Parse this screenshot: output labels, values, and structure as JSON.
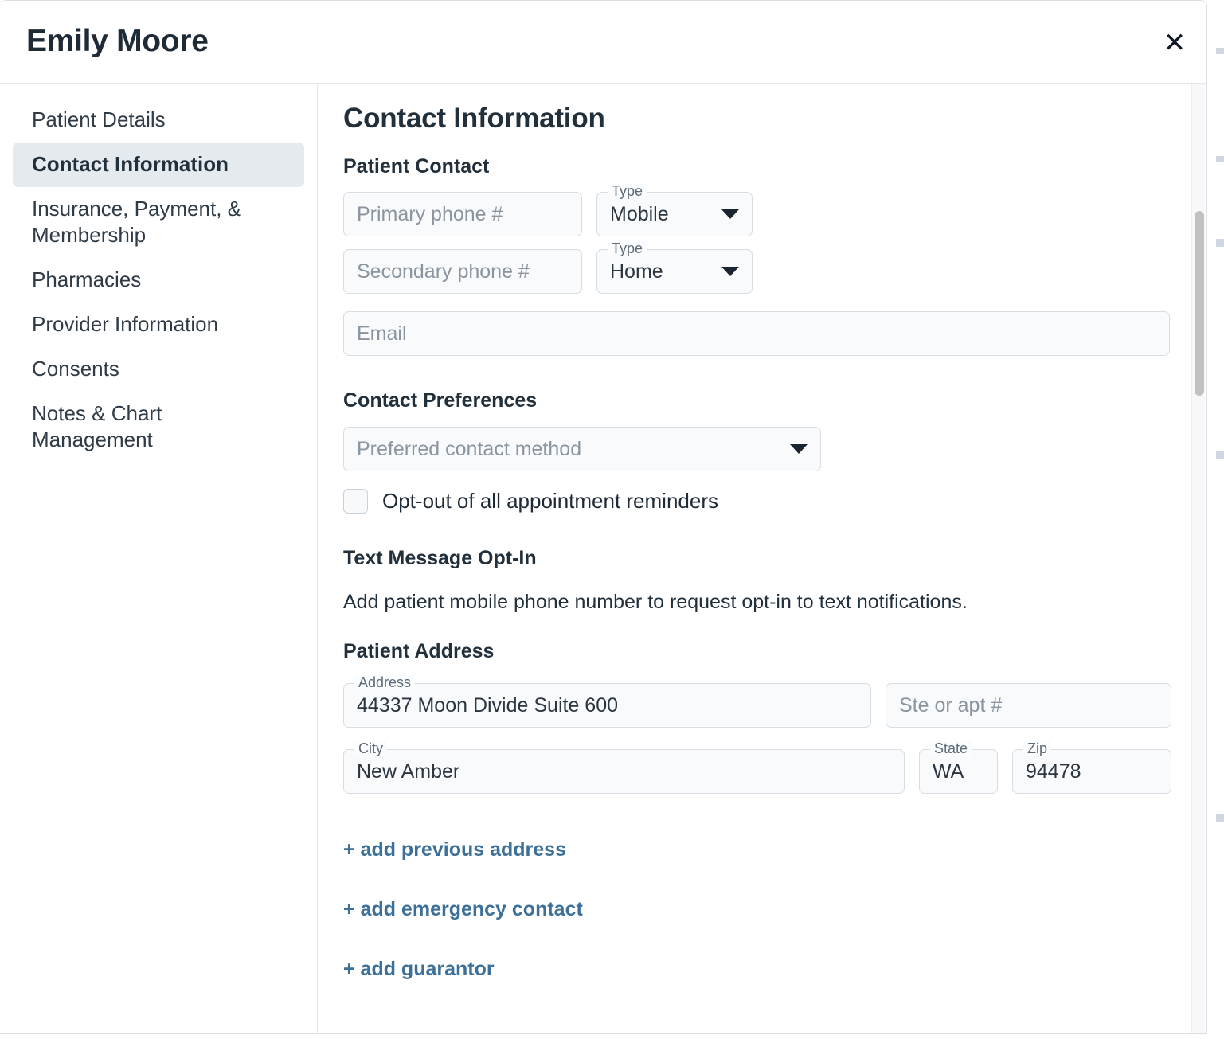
{
  "dialog": {
    "title": "Emily Moore",
    "close_icon": "close-icon"
  },
  "sidebar": {
    "items": [
      {
        "label": "Patient Details",
        "active": false
      },
      {
        "label": "Contact Information",
        "active": true
      },
      {
        "label": "Insurance, Payment, & Membership",
        "active": false
      },
      {
        "label": "Pharmacies",
        "active": false
      },
      {
        "label": "Provider Information",
        "active": false
      },
      {
        "label": "Consents",
        "active": false
      },
      {
        "label": "Notes & Chart Management",
        "active": false
      }
    ]
  },
  "main": {
    "section_title": "Contact Information",
    "patient_contact": {
      "heading": "Patient Contact",
      "primary_phone": {
        "label": "",
        "placeholder": "Primary phone #",
        "value": ""
      },
      "primary_type": {
        "label": "Type",
        "value": "Mobile"
      },
      "secondary_phone": {
        "label": "",
        "placeholder": "Secondary phone #",
        "value": ""
      },
      "secondary_type": {
        "label": "Type",
        "value": "Home"
      },
      "email": {
        "label": "",
        "placeholder": "Email",
        "value": ""
      }
    },
    "contact_preferences": {
      "heading": "Contact Preferences",
      "preferred_method": {
        "placeholder": "Preferred contact method",
        "value": ""
      },
      "optout_label": "Opt-out of all appointment reminders",
      "optout_checked": false
    },
    "text_opt_in": {
      "heading": "Text Message Opt-In",
      "description": "Add patient mobile phone number to request opt-in to text notifications."
    },
    "patient_address": {
      "heading": "Patient Address",
      "address": {
        "label": "Address",
        "value": "44337 Moon Divide Suite 600",
        "placeholder": ""
      },
      "suite": {
        "label": "",
        "value": "",
        "placeholder": "Ste or apt #"
      },
      "city": {
        "label": "City",
        "value": "New Amber",
        "placeholder": ""
      },
      "state": {
        "label": "State",
        "value": "WA",
        "placeholder": ""
      },
      "zip": {
        "label": "Zip",
        "value": "94478",
        "placeholder": ""
      }
    },
    "actions": [
      {
        "label": "+ add previous address"
      },
      {
        "label": "+ add emergency contact"
      },
      {
        "label": "+ add guarantor"
      }
    ]
  },
  "colors": {
    "accent_link": "#3d7099",
    "active_nav_bg": "#e4eaee",
    "field_bg": "#f8fafb",
    "text_primary": "#22303c",
    "placeholder": "#8a959f"
  }
}
